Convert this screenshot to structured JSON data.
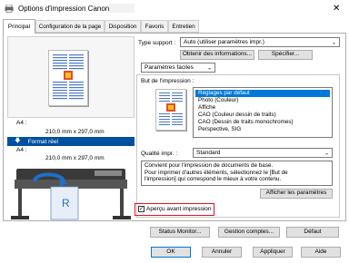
{
  "window": {
    "title": "Options d'impression Canon"
  },
  "tabs": [
    {
      "label": "Principal",
      "selected": true
    },
    {
      "label": "Configuration de la page",
      "selected": false
    },
    {
      "label": "Disposition",
      "selected": false
    },
    {
      "label": "Favoris",
      "selected": false
    },
    {
      "label": "Entretien",
      "selected": false
    }
  ],
  "preview": {
    "size_label_1": "A4 :",
    "size_value_1": "210,0 mm x 297,0 mm",
    "format_label": "Format réel",
    "size_label_2": "A4 :",
    "size_value_2": "210,0 mm x 297,0 mm"
  },
  "media": {
    "label": "Type support :",
    "value": "Auto (utiliser paramètres impr.)",
    "get_info_button": "Obtenir des informations...",
    "specify_button": "Spécifier..."
  },
  "settings_mode": {
    "value": "Paramètres faciles"
  },
  "purpose": {
    "label": "But de l'impression :",
    "items": [
      {
        "label": "Réglages par défaut",
        "selected": true
      },
      {
        "label": "Photo (Couleur)",
        "selected": false
      },
      {
        "label": "Affiche",
        "selected": false
      },
      {
        "label": "CAO (Couleur dessin de traits)",
        "selected": false
      },
      {
        "label": "CAO (Dessin de traits monochromes)",
        "selected": false
      },
      {
        "label": "Perspective, SIG",
        "selected": false
      }
    ]
  },
  "quality": {
    "label": "Qualité impr. :",
    "value": "Standard"
  },
  "description": {
    "line1": "Convient pour l'impression de documents de base.",
    "line2": "Pour imprimer d'autres éléments, sélectionnez le [But de",
    "line3": "l'impression] qui correspond le mieux à votre contenu."
  },
  "show_settings_button": "Afficher les paramètres",
  "print_preview_checkbox": {
    "label": "Aperçu avant impression",
    "checked": true
  },
  "bottom_buttons": {
    "status_monitor": "Status Monitor...",
    "account_management": "Gestion comptes...",
    "defaults": "Défaut"
  },
  "dialog_buttons": {
    "ok": "OK",
    "cancel": "Annuler",
    "apply": "Appliquer",
    "help": "Aide"
  },
  "colors": {
    "selection": "#0078d7",
    "highlight_border": "#e81123",
    "dialog_bg": "#f0f0f0"
  }
}
